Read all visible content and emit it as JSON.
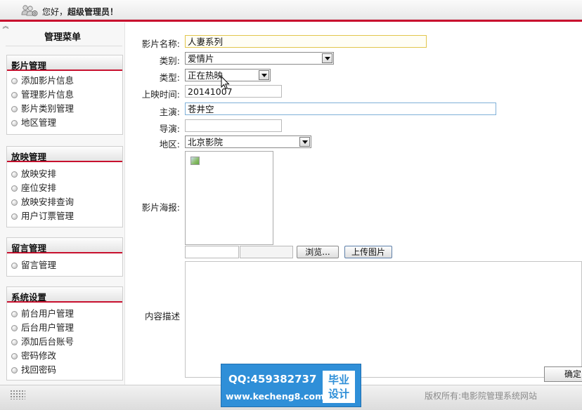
{
  "header": {
    "greeting_prefix": "您好，",
    "greeting_user": "超级管理员",
    "greeting_suffix": "！"
  },
  "menu": {
    "title": "管理菜单",
    "groups": [
      {
        "title": "影片管理",
        "items": [
          "添加影片信息",
          "管理影片信息",
          "影片类别管理",
          "地区管理"
        ]
      },
      {
        "title": "放映管理",
        "items": [
          "放映安排",
          "座位安排",
          "放映安排查询",
          "用户订票管理"
        ]
      },
      {
        "title": "留言管理",
        "items": [
          "留言管理"
        ]
      },
      {
        "title": "系统设置",
        "items": [
          "前台用户管理",
          "后台用户管理",
          "添加后台账号",
          "密码修改",
          "找回密码"
        ]
      }
    ]
  },
  "form": {
    "name_label": "影片名称:",
    "name_value": "人妻系列",
    "category_label": "类别:",
    "category_value": "爱情片",
    "type_label": "类型:",
    "type_value": "正在热映",
    "date_label": "上映时间:",
    "date_value": "20141007",
    "star_label": "主演:",
    "star_value": "苍井空",
    "director_label": "导演:",
    "director_value": "",
    "region_label": "地区:",
    "region_value": "北京影院",
    "poster_label": "影片海报:",
    "browse_label": "浏览...",
    "upload_label": "上传图片",
    "desc_label": "内容描述",
    "confirm_label": "确定"
  },
  "footer": {
    "copyright": "版权所有:电影院管理系统网站"
  },
  "watermark": {
    "qq": "QQ:459382737",
    "url": "www.kecheng8.com",
    "badge_line1": "毕业",
    "badge_line2": "设计"
  },
  "colors": {
    "accent_red": "#c8102e",
    "watermark_blue": "#2f8fd8"
  }
}
